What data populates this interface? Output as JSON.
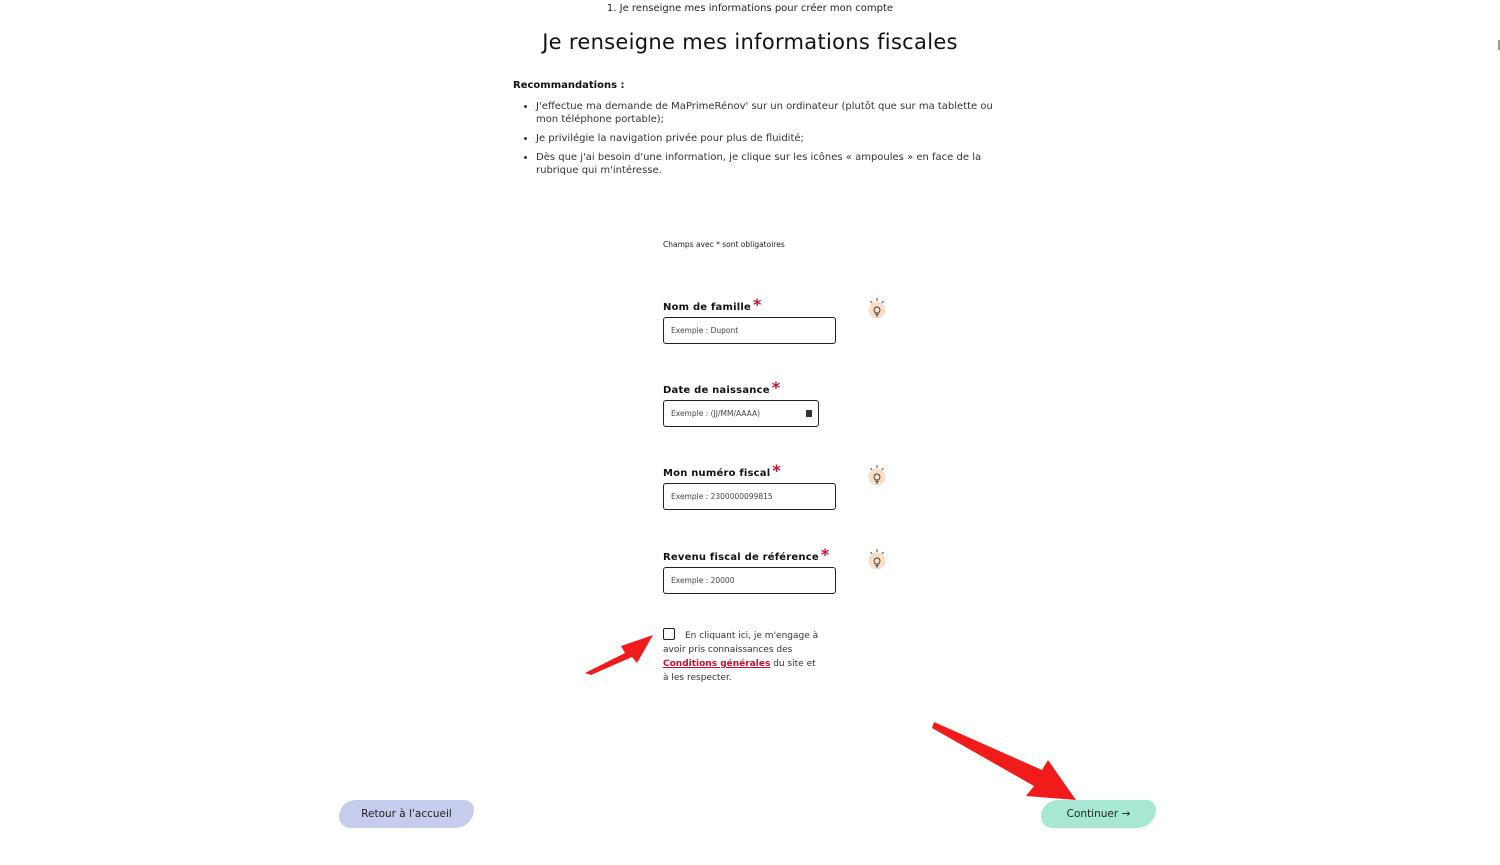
{
  "step": "1. Je renseigne mes informations pour créer mon compte",
  "title": "Je renseigne mes informations fiscales",
  "recommendations": {
    "title": "Recommandations :",
    "items": [
      "J'effectue ma demande de MaPrimeRénov' sur un ordinateur (plutôt que sur ma tablette ou mon téléphone portable);",
      "Je privilégie la navigation privée pour plus de fluidité;",
      "Dès que j'ai besoin d'une information, je clique sur les icônes « ampoules » en face de la rubrique qui m'intéresse."
    ]
  },
  "required_note": "Champs avec * sont obligatoires",
  "form": {
    "nom": {
      "label": "Nom de famille",
      "required": "*",
      "placeholder": "Exemple : Dupont"
    },
    "naissance": {
      "label": "Date de naissance",
      "required": "*",
      "placeholder": "Exemple : (JJ/MM/AAAA)"
    },
    "fiscal": {
      "label": "Mon numéro fiscal",
      "required": "*",
      "placeholder": "Exemple : 2300000099815"
    },
    "revenu": {
      "label": "Revenu fiscal de référence",
      "required": "*",
      "placeholder": "Exemple : 20000"
    }
  },
  "consent": {
    "checked": false,
    "text_before": "En cliquant ici, je m'engage à avoir pris connaissances des",
    "link": "Conditions générales",
    "text_after": "du site et à les respecter."
  },
  "buttons": {
    "home": "Retour à l'accueil",
    "continue": "Continuer →"
  },
  "colors": {
    "required_star": "#c8102e",
    "home_button": "#c5ccec",
    "continue_button": "#a6e8d3",
    "annotation_arrow": "#f01c1c"
  },
  "icons": [
    "lightbulb-icon",
    "calendar-icon",
    "arrow-right-icon"
  ]
}
